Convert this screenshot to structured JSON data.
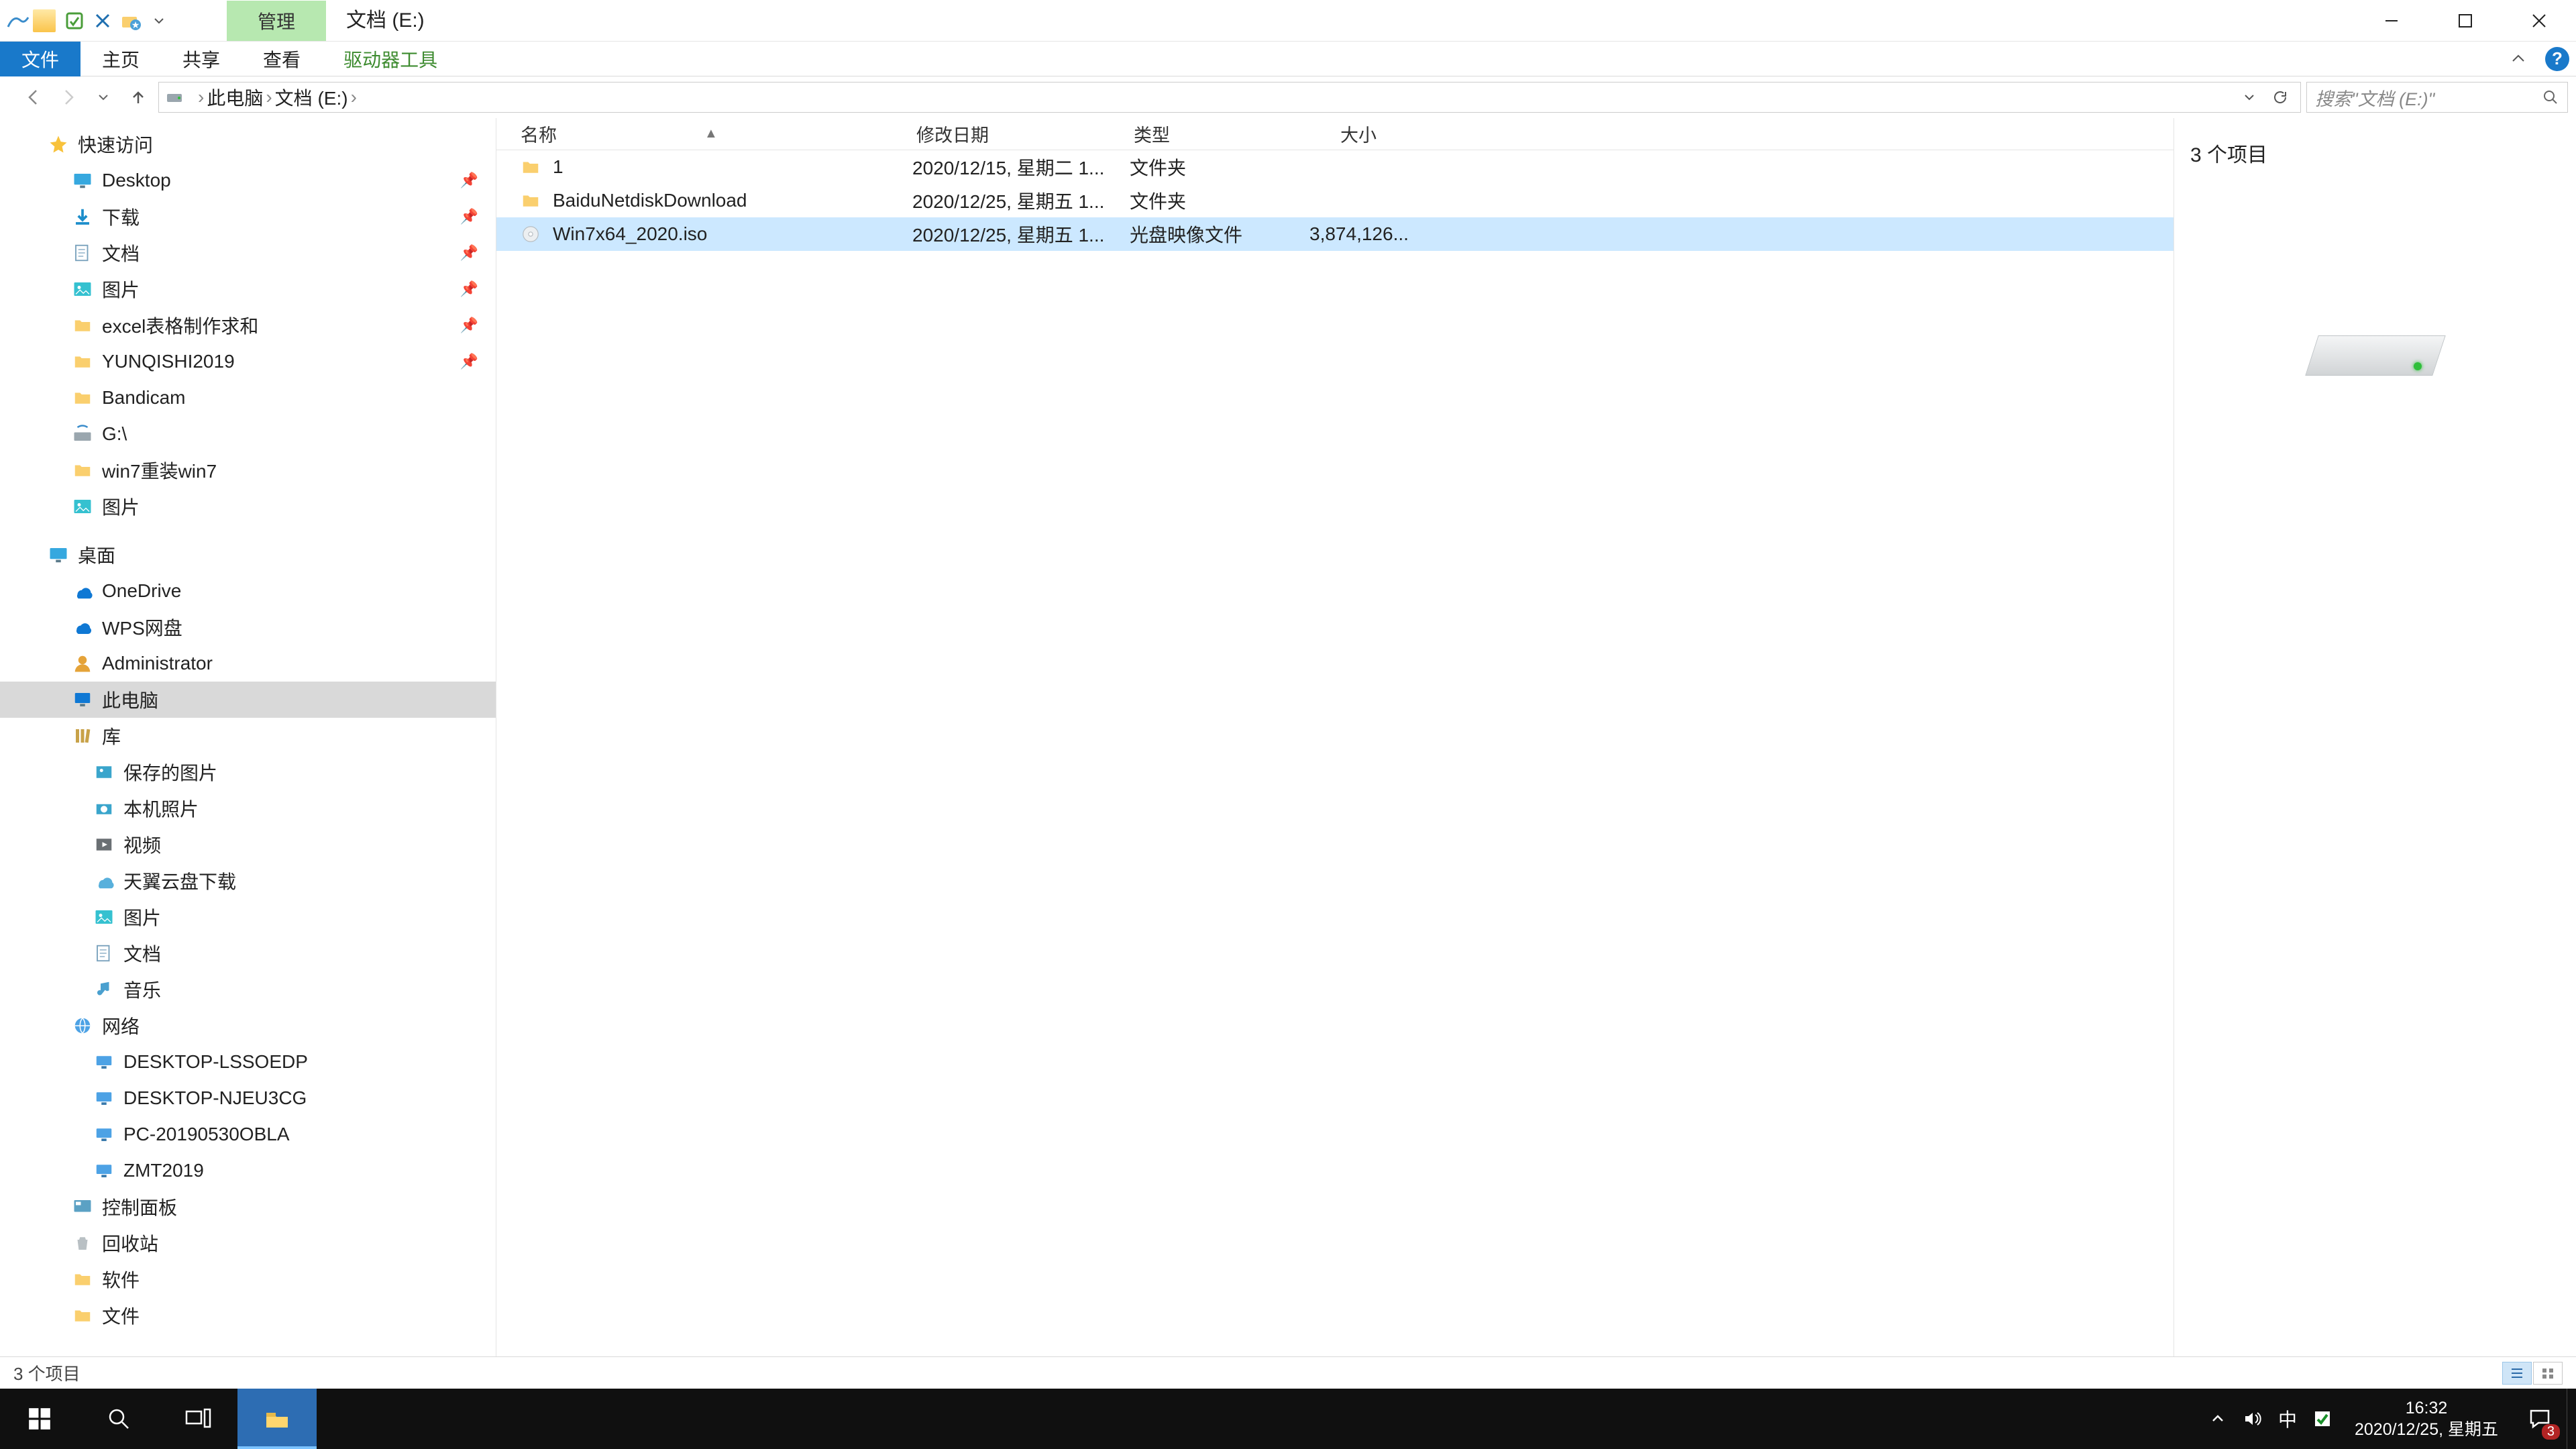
{
  "title": {
    "contextual_tab": "管理",
    "window_title": "文档 (E:)"
  },
  "ribbon": {
    "file": "文件",
    "home": "主页",
    "share": "共享",
    "view": "查看",
    "drive_tools": "驱动器工具"
  },
  "addr": {
    "root_icon": "pc-icon",
    "crumbs": [
      "此电脑",
      "文档 (E:)"
    ],
    "search_placeholder": "搜索\"文档 (E:)\""
  },
  "nav": {
    "quick_access": "快速访问",
    "items_quick": [
      {
        "icon": "desktop-icon",
        "label": "Desktop",
        "pinned": true
      },
      {
        "icon": "download-icon",
        "label": "下载",
        "pinned": true
      },
      {
        "icon": "doc-folder-icon",
        "label": "文档",
        "pinned": true
      },
      {
        "icon": "picture-icon",
        "label": "图片",
        "pinned": true
      },
      {
        "icon": "folder-icon",
        "label": "excel表格制作求和",
        "pinned": true
      },
      {
        "icon": "folder-icon",
        "label": "YUNQISHI2019",
        "pinned": true
      },
      {
        "icon": "folder-icon",
        "label": "Bandicam",
        "pinned": false
      },
      {
        "icon": "drive-g-icon",
        "label": "G:\\",
        "pinned": false
      },
      {
        "icon": "folder-icon",
        "label": "win7重装win7",
        "pinned": false
      },
      {
        "icon": "picture-icon",
        "label": "图片",
        "pinned": false
      }
    ],
    "desktop": "桌面",
    "desktop_children": [
      {
        "icon": "onedrive-icon",
        "label": "OneDrive"
      },
      {
        "icon": "wps-icon",
        "label": "WPS网盘"
      },
      {
        "icon": "user-icon",
        "label": "Administrator"
      },
      {
        "icon": "pc-icon",
        "label": "此电脑"
      },
      {
        "icon": "library-icon",
        "label": "库"
      }
    ],
    "library_children": [
      {
        "icon": "saved-pictures-icon",
        "label": "保存的图片"
      },
      {
        "icon": "camera-roll-icon",
        "label": "本机照片"
      },
      {
        "icon": "video-icon",
        "label": "视频"
      },
      {
        "icon": "cloud-download-icon",
        "label": "天翼云盘下载"
      },
      {
        "icon": "picture-icon",
        "label": "图片"
      },
      {
        "icon": "doc-folder-icon",
        "label": "文档"
      },
      {
        "icon": "music-icon",
        "label": "音乐"
      }
    ],
    "network": "网络",
    "network_children": [
      {
        "label": "DESKTOP-LSSOEDP"
      },
      {
        "label": "DESKTOP-NJEU3CG"
      },
      {
        "label": "PC-20190530OBLA"
      },
      {
        "label": "ZMT2019"
      }
    ],
    "control_panel": "控制面板",
    "recycle_bin": "回收站",
    "software": "软件",
    "file_folder": "文件"
  },
  "columns": {
    "name": "名称",
    "date": "修改日期",
    "type": "类型",
    "size": "大小"
  },
  "rows": [
    {
      "icon": "folder-icon",
      "name": "1",
      "date": "2020/12/15, 星期二 1...",
      "type": "文件夹",
      "size": ""
    },
    {
      "icon": "folder-icon",
      "name": "BaiduNetdiskDownload",
      "date": "2020/12/25, 星期五 1...",
      "type": "文件夹",
      "size": ""
    },
    {
      "icon": "iso-icon",
      "name": "Win7x64_2020.iso",
      "date": "2020/12/25, 星期五 1...",
      "type": "光盘映像文件",
      "size": "3,874,126...",
      "selected": true
    }
  ],
  "details": {
    "count_label": "3 个项目"
  },
  "status": {
    "text": "3 个项目"
  },
  "taskbar": {
    "time": "16:32",
    "date": "2020/12/25, 星期五",
    "ime": "中",
    "notif_count": "3"
  }
}
